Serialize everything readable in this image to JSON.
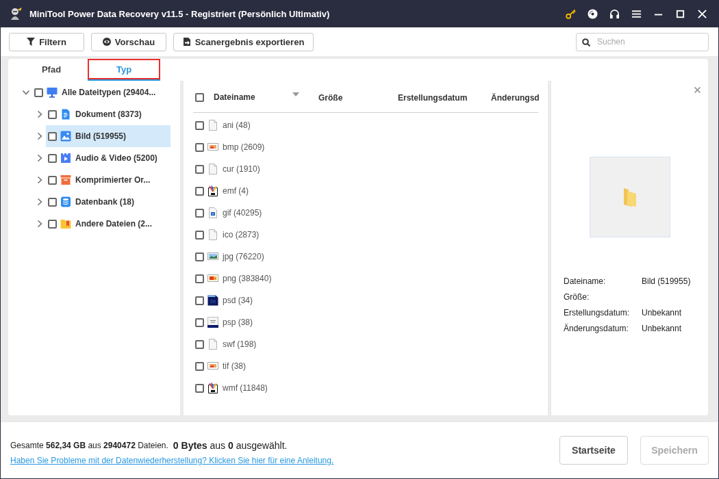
{
  "window": {
    "title": "MiniTool Power Data Recovery v11.5 - Registriert (Persönlich Ultimativ)"
  },
  "toolbar": {
    "buttons": [
      {
        "kind": "filter",
        "label": "Filtern"
      },
      {
        "kind": "preview",
        "label": "Vorschau"
      },
      {
        "kind": "export",
        "label": "Scanergebnis exportieren"
      }
    ],
    "search": {
      "placeholder": "Suchen"
    }
  },
  "tabs": [
    {
      "label": "Pfad",
      "selected": false,
      "highlighted": false
    },
    {
      "label": "Typ",
      "selected": true,
      "highlighted": true
    }
  ],
  "tree": [
    {
      "kind": "computer",
      "label": "Alle Dateitypen (29404...",
      "checked": false,
      "expanded": true,
      "selected": false,
      "children": [
        {
          "kind": "document",
          "label": "Dokument (8373)",
          "checked": false,
          "expanded": false,
          "selected": false
        },
        {
          "kind": "image",
          "label": "Bild (519955)",
          "checked": false,
          "expanded": false,
          "selected": true
        },
        {
          "kind": "media",
          "label": "Audio & Video (5200)",
          "checked": false,
          "expanded": false,
          "selected": false
        },
        {
          "kind": "archive",
          "label": "Komprimierter Or...",
          "checked": false,
          "expanded": false,
          "selected": false
        },
        {
          "kind": "database",
          "label": "Datenbank (18)",
          "checked": false,
          "expanded": false,
          "selected": false
        },
        {
          "kind": "other",
          "label": "Andere Dateien (2...",
          "checked": false,
          "expanded": false,
          "selected": false
        }
      ]
    }
  ],
  "table": {
    "all_checked": false,
    "columns": [
      {
        "label": "Dateiname",
        "sorted": true
      },
      {
        "label": "Größe",
        "sorted": false
      },
      {
        "label": "Erstellungsdatum",
        "sorted": false
      },
      {
        "label": "Änderungsd",
        "sorted": false
      }
    ],
    "rows": [
      {
        "kind": "blank",
        "name": "ani (48)",
        "checked": false
      },
      {
        "kind": "bitmap",
        "name": "bmp (2609)",
        "checked": false
      },
      {
        "kind": "blank",
        "name": "cur (1910)",
        "checked": false
      },
      {
        "kind": "metafile",
        "name": "emf (4)",
        "checked": false
      },
      {
        "kind": "gif",
        "name": "gif (40295)",
        "checked": false
      },
      {
        "kind": "blank",
        "name": "ico (2873)",
        "checked": false
      },
      {
        "kind": "photo",
        "name": "jpg (76220)",
        "checked": false
      },
      {
        "kind": "png",
        "name": "png (383840)",
        "checked": false
      },
      {
        "kind": "psd",
        "name": "psd (34)",
        "checked": false
      },
      {
        "kind": "psp",
        "name": "psp (38)",
        "checked": false
      },
      {
        "kind": "blank",
        "name": "swf (198)",
        "checked": false
      },
      {
        "kind": "bitmap",
        "name": "tif (38)",
        "checked": false
      },
      {
        "kind": "metafile",
        "name": "wmf (11848)",
        "checked": false
      }
    ]
  },
  "preview": {
    "info": [
      {
        "label": "Dateiname:",
        "value": "Bild (519955)"
      },
      {
        "label": "Größe:"
      },
      {
        "label": "Erstellungsdatum:",
        "value": "Unbekannt"
      },
      {
        "label": "Änderungsdatum:",
        "value": "Unbekannt"
      }
    ]
  },
  "footer": {
    "summary": "Gesamte **562,34 GB** aus **2940472** Dateien.",
    "selection": "**0 Bytes** aus **0** ausgewählt.",
    "help_link": "Haben Sie Probleme mit der Datenwiederherstellung? Klicken Sie hier für eine Anleitung.",
    "buttons": [
      {
        "label": "Startseite",
        "disabled": false
      },
      {
        "label": "Speichern",
        "disabled": true
      }
    ]
  }
}
